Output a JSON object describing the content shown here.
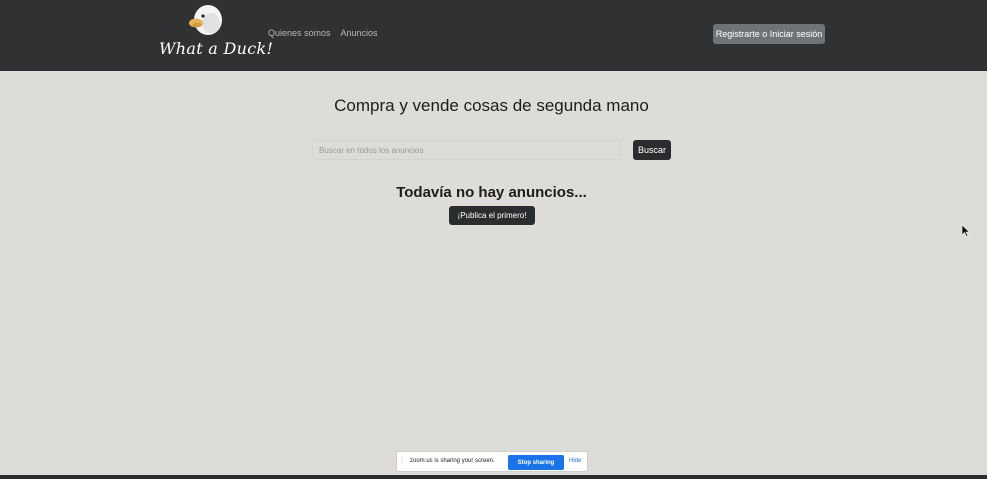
{
  "brand": {
    "name": "What a Duck!",
    "logo_icon": "duck-icon"
  },
  "nav": {
    "links": [
      {
        "label": "Quienes somos"
      },
      {
        "label": "Anuncios"
      }
    ],
    "login_label": "Registrarte o Iniciar sesión"
  },
  "main": {
    "title": "Compra y vende cosas de segunda mano",
    "search": {
      "placeholder": "Buscar en todos los anuncios",
      "value": "",
      "button_label": "Buscar"
    },
    "empty_state": {
      "title": "Todavía no hay anuncios...",
      "button_label": "¡Publica el primero!"
    }
  },
  "share_bar": {
    "text": "zoom.us is sharing your screen.",
    "stop_label": "Stop sharing",
    "hide_label": "Hide"
  },
  "colors": {
    "navbar_bg": "#2f3133",
    "page_bg": "#dddcd8",
    "dark_button": "#2b2c2e",
    "zoom_blue": "#1a73e8"
  }
}
